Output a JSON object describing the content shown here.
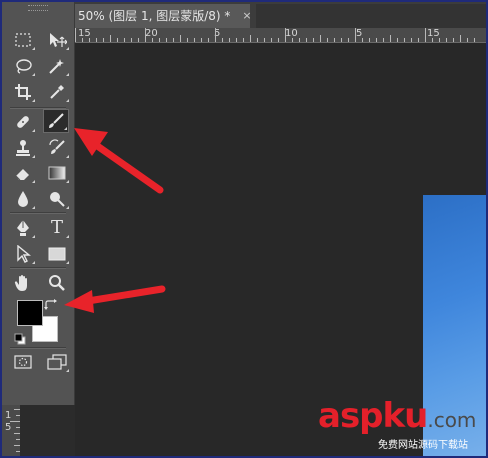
{
  "document": {
    "tab_title": "50% (图层 1, 图层蒙版/8) *",
    "close_glyph": "×"
  },
  "ruler": {
    "top_labels": [
      "15",
      "20",
      "5",
      "10",
      "5",
      "15"
    ],
    "left_labels": [
      "1",
      "5"
    ]
  },
  "toolbox": {
    "tools": [
      {
        "name": "rectangular-marquee-tool",
        "icon": "marquee-icon"
      },
      {
        "name": "move-tool",
        "icon": "move-icon"
      },
      {
        "name": "lasso-tool",
        "icon": "lasso-icon"
      },
      {
        "name": "magic-wand-tool",
        "icon": "magic-wand-icon"
      },
      {
        "name": "crop-tool",
        "icon": "crop-icon"
      },
      {
        "name": "eyedropper-tool",
        "icon": "eyedropper-icon"
      },
      {
        "name": "spot-healing-brush-tool",
        "icon": "bandage-icon"
      },
      {
        "name": "brush-tool",
        "icon": "brush-icon",
        "active": true
      },
      {
        "name": "clone-stamp-tool",
        "icon": "stamp-icon"
      },
      {
        "name": "history-brush-tool",
        "icon": "history-brush-icon"
      },
      {
        "name": "eraser-tool",
        "icon": "eraser-icon"
      },
      {
        "name": "gradient-tool",
        "icon": "gradient-icon"
      },
      {
        "name": "blur-tool",
        "icon": "drop-icon"
      },
      {
        "name": "dodge-tool",
        "icon": "dodge-icon"
      },
      {
        "name": "pen-tool",
        "icon": "pen-icon"
      },
      {
        "name": "type-tool",
        "icon": "type-icon",
        "label": "T"
      },
      {
        "name": "path-selection-tool",
        "icon": "arrow-pointer-icon"
      },
      {
        "name": "rectangle-tool",
        "icon": "rectangle-icon"
      },
      {
        "name": "hand-tool",
        "icon": "hand-icon"
      },
      {
        "name": "zoom-tool",
        "icon": "zoom-icon"
      }
    ],
    "foreground_color": "#000000",
    "background_color": "#ffffff"
  },
  "annotations": {
    "arrow_color": "#e8232a"
  },
  "watermark": {
    "main": "aspku",
    "suffix": ".com",
    "sub": "免费网站源码下载站"
  }
}
